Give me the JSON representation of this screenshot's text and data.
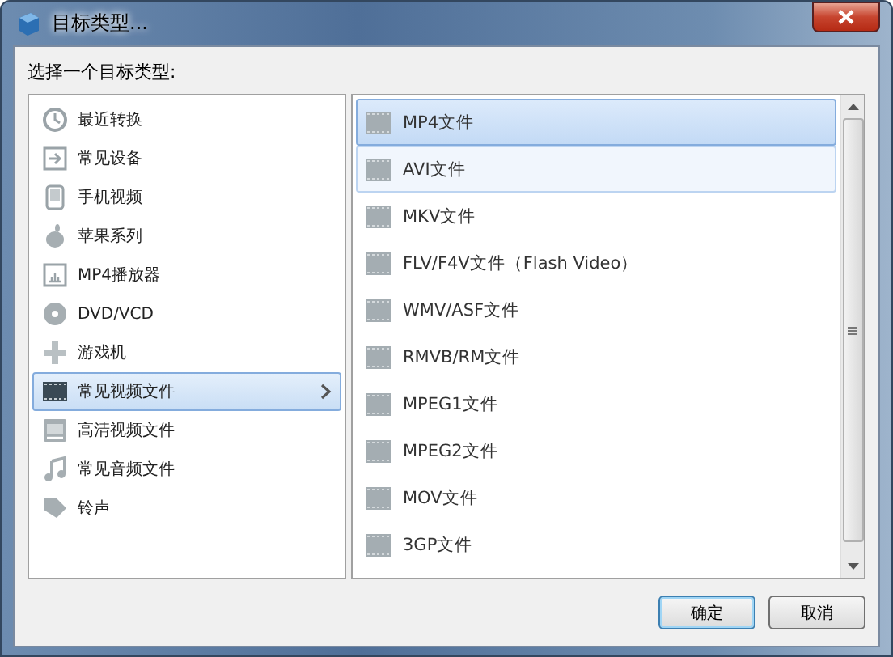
{
  "window": {
    "title": "目标类型..."
  },
  "prompt": "选择一个目标类型:",
  "categories": [
    {
      "label": "最近转换",
      "kind": "clock",
      "selected": false
    },
    {
      "label": "常见设备",
      "kind": "device",
      "selected": false
    },
    {
      "label": "手机视频",
      "kind": "phone",
      "selected": false
    },
    {
      "label": "苹果系列",
      "kind": "fruit",
      "selected": false
    },
    {
      "label": "MP4播放器",
      "kind": "player",
      "selected": false
    },
    {
      "label": "DVD/VCD",
      "kind": "disc",
      "selected": false
    },
    {
      "label": "游戏机",
      "kind": "gamepad",
      "selected": false
    },
    {
      "label": "常见视频文件",
      "kind": "film",
      "selected": true
    },
    {
      "label": "高清视频文件",
      "kind": "hd",
      "selected": false
    },
    {
      "label": "常见音频文件",
      "kind": "music",
      "selected": false
    },
    {
      "label": "铃声",
      "kind": "tag",
      "selected": false
    }
  ],
  "formats": [
    {
      "label": "MP4文件",
      "selected": true,
      "hovered": false
    },
    {
      "label": "AVI文件",
      "selected": false,
      "hovered": true
    },
    {
      "label": "MKV文件",
      "selected": false,
      "hovered": false
    },
    {
      "label": "FLV/F4V文件（Flash Video）",
      "selected": false,
      "hovered": false
    },
    {
      "label": "WMV/ASF文件",
      "selected": false,
      "hovered": false
    },
    {
      "label": "RMVB/RM文件",
      "selected": false,
      "hovered": false
    },
    {
      "label": "MPEG1文件",
      "selected": false,
      "hovered": false
    },
    {
      "label": "MPEG2文件",
      "selected": false,
      "hovered": false
    },
    {
      "label": "MOV文件",
      "selected": false,
      "hovered": false
    },
    {
      "label": "3GP文件",
      "selected": false,
      "hovered": false
    }
  ],
  "buttons": [
    "确定",
    "取消"
  ]
}
